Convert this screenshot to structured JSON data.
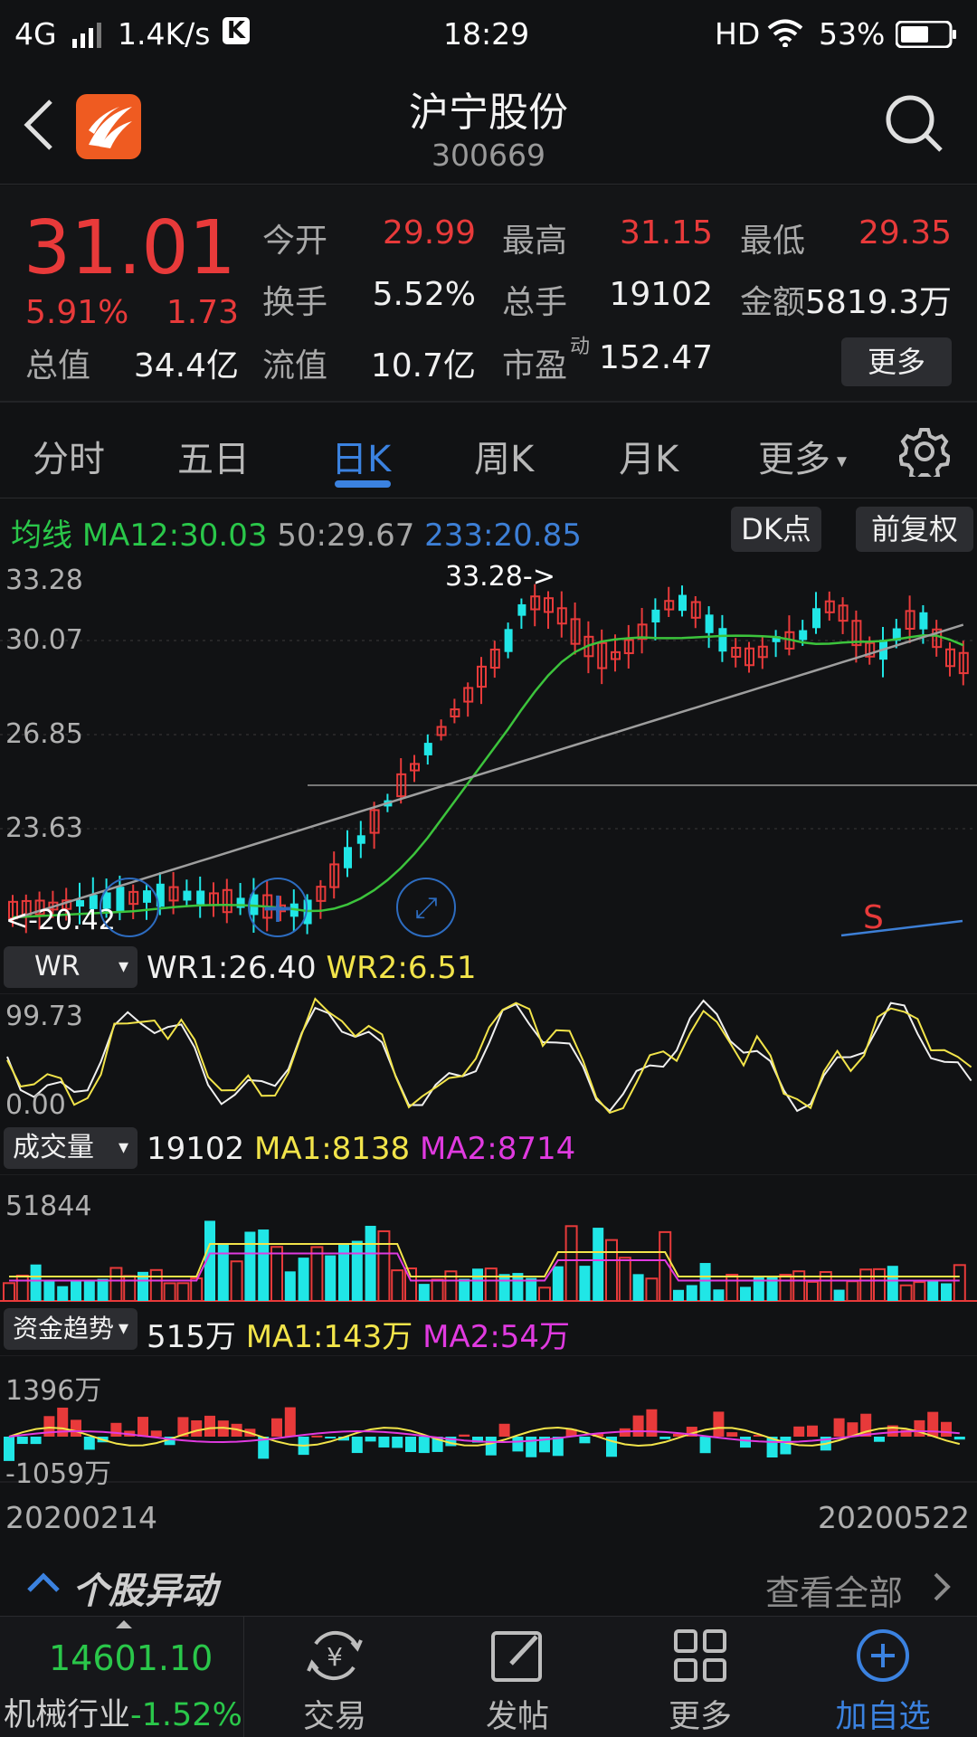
{
  "status": {
    "network": "4G",
    "speed": "1.4K/s",
    "time": "18:29",
    "hd": "HD",
    "battery": "53%"
  },
  "header": {
    "name": "沪宁股份",
    "code": "300669"
  },
  "quote": {
    "price": "31.01",
    "change_pct": "5.91%",
    "change": "1.73",
    "open_label": "今开",
    "open": "29.99",
    "high_label": "最高",
    "high": "31.15",
    "low_label": "最低",
    "low": "29.35",
    "turnover_label": "换手",
    "turnover": "5.52%",
    "volume_label": "总手",
    "volume": "19102",
    "amount_label": "金额",
    "amount": "5819.3万",
    "mktcap_label": "总值",
    "mktcap": "34.4亿",
    "float_label": "流值",
    "float": "10.7亿",
    "pe_label": "市盈",
    "pe_sup": "动",
    "pe": "152.47",
    "more_label": "更多"
  },
  "tabs": [
    {
      "label": "分时"
    },
    {
      "label": "五日"
    },
    {
      "label": "日K"
    },
    {
      "label": "周K"
    },
    {
      "label": "月K"
    },
    {
      "label": "更多"
    }
  ],
  "ma": {
    "label": "均线",
    "ma12": "MA12:30.03",
    "ma50": "50:29.67",
    "ma233": "233:20.85",
    "dk_label": "DK点",
    "adj_label": "前复权"
  },
  "kline": {
    "y_max": "33.28",
    "y_2": "30.07",
    "y_3": "26.85",
    "y_4": "23.63",
    "high_marker": "33.28->",
    "low_marker": "<-20.42",
    "signal": "S"
  },
  "wr": {
    "selector": "WR",
    "wr1": "WR1:26.40",
    "wr2": "WR2:6.51",
    "y_max": "99.73",
    "y_min": "0.00"
  },
  "vol": {
    "selector": "成交量",
    "value": "19102",
    "ma1": "MA1:8138",
    "ma2": "MA2:8714",
    "y_max": "51844"
  },
  "fund": {
    "selector": "资金趋势",
    "value": "515万",
    "ma1": "MA1:143万",
    "ma2": "MA2:54万",
    "y_max": "1396万",
    "y_min": "-1059万"
  },
  "dates": {
    "start": "20200214",
    "end": "20200522"
  },
  "news": {
    "title": "个股异动",
    "view_all": "查看全部"
  },
  "bottom": {
    "index_value": "14601.10",
    "industry": "机械行业",
    "industry_change": "-1.52%",
    "trade": "交易",
    "post": "发帖",
    "more": "更多",
    "add_watch": "加自选"
  },
  "colors": {
    "up": "#e83a3a",
    "down": "#20e6e6",
    "accent": "#3b82e0",
    "ma12": "#3cc43c",
    "ma50": "#9e9e9e",
    "ma233": "#3d7fd6",
    "yellow": "#f2e44a",
    "magenta": "#e03ae0"
  }
}
